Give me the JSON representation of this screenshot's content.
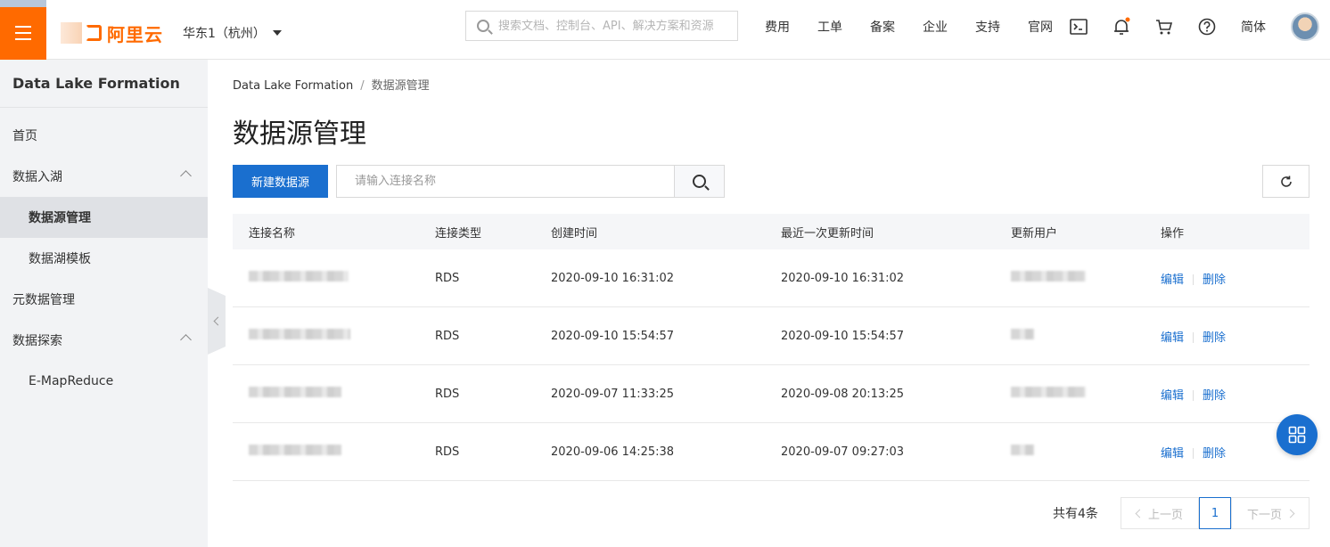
{
  "topbar": {
    "logo_text": "阿里云",
    "region": "华东1（杭州）",
    "search_placeholder": "搜索文档、控制台、API、解决方案和资源",
    "links": [
      "费用",
      "工单",
      "备案",
      "企业",
      "支持",
      "官网"
    ],
    "icons": [
      "terminal-icon",
      "bell-icon",
      "cart-icon",
      "help-icon"
    ],
    "lang": "简体"
  },
  "sidebar": {
    "title": "Data Lake Formation",
    "items": [
      {
        "label": "首页"
      },
      {
        "label": "数据入湖"
      },
      {
        "label": "数据源管理"
      },
      {
        "label": "数据湖模板"
      },
      {
        "label": "元数据管理"
      },
      {
        "label": "数据探索"
      },
      {
        "label": "E-MapReduce"
      }
    ]
  },
  "main": {
    "breadcrumb": {
      "root": "Data Lake Formation",
      "sep": "/",
      "current": "数据源管理"
    },
    "title": "数据源管理",
    "new_button": "新建数据源",
    "search_placeholder": "请输入连接名称",
    "table": {
      "headers": [
        "连接名称",
        "连接类型",
        "创建时间",
        "最近一次更新时间",
        "更新用户",
        "操作"
      ],
      "rows": [
        {
          "type": "RDS",
          "created": "2020-09-10 16:31:02",
          "updated": "2020-09-10 16:31:02"
        },
        {
          "type": "RDS",
          "created": "2020-09-10 15:54:57",
          "updated": "2020-09-10 15:54:57"
        },
        {
          "type": "RDS",
          "created": "2020-09-07 11:33:25",
          "updated": "2020-09-08 20:13:25"
        },
        {
          "type": "RDS",
          "created": "2020-09-06 14:25:38",
          "updated": "2020-09-07 09:27:03"
        }
      ],
      "actions": {
        "edit": "编辑",
        "delete": "删除"
      }
    },
    "pagination": {
      "total": "共有4条",
      "prev": "上一页",
      "current": "1",
      "next": "下一页"
    }
  },
  "colors": {
    "brand": "#ff6a00",
    "primary": "#1a6fcf"
  }
}
